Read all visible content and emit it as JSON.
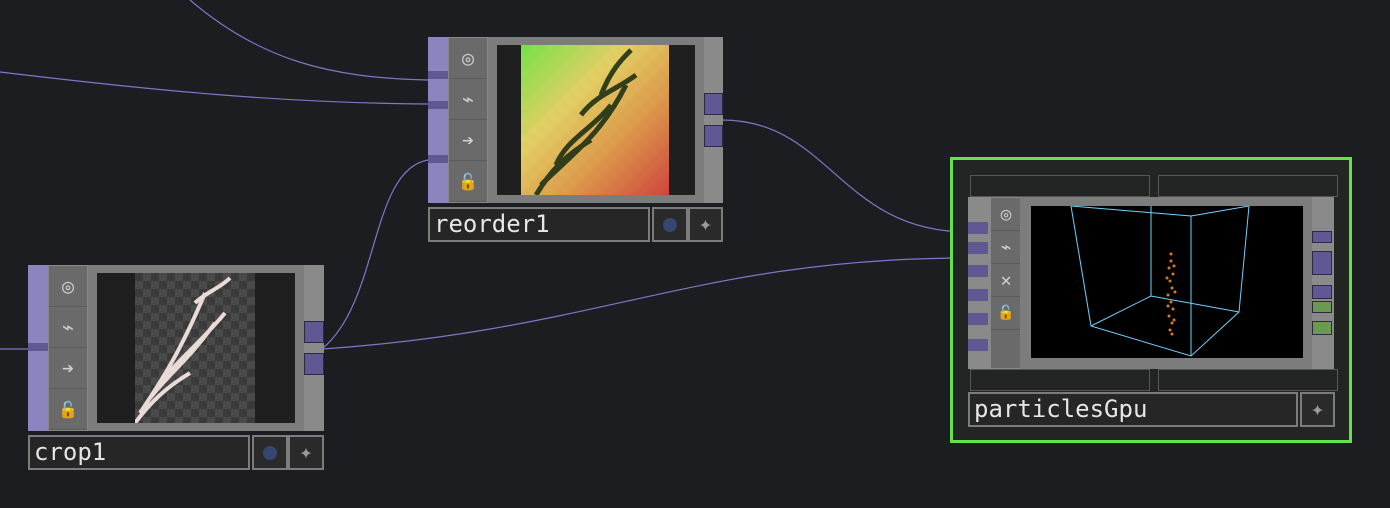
{
  "nodes": {
    "reorder": {
      "name": "reorder1",
      "controls": [
        "viewer-icon",
        "cook-icon",
        "bypass-icon",
        "lock-icon"
      ]
    },
    "crop": {
      "name": "crop1",
      "controls": [
        "viewer-icon",
        "cook-icon",
        "bypass-icon",
        "lock-icon"
      ]
    },
    "particles": {
      "name": "particlesGpu",
      "selected": true,
      "controls": [
        "viewer-icon",
        "cook-icon",
        "close-icon",
        "lock-icon"
      ]
    }
  },
  "colors": {
    "background": "#1c1d21",
    "wire": "#8d86d8",
    "node_side": "#8c84bf",
    "port": "#5f5893",
    "selection": "#63e24a",
    "bounding_box": "#6fd3ff"
  },
  "icons": {
    "viewer": "◎",
    "cook": "⌁",
    "bypass": "➔",
    "close": "✕",
    "lock": "🔓",
    "flag": "✦"
  }
}
